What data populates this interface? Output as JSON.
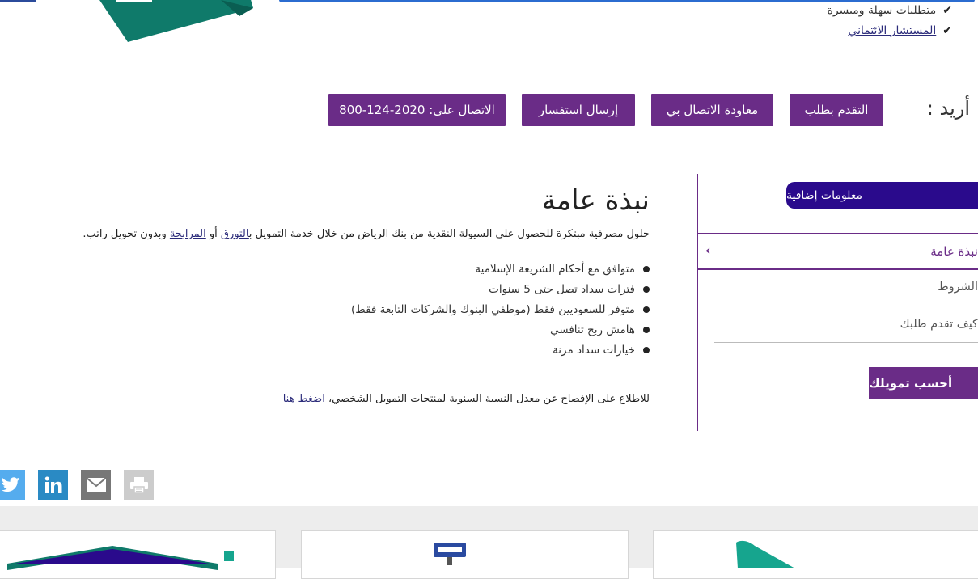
{
  "features": [
    {
      "label": "متطلبات سهلة وميسرة",
      "link": false
    },
    {
      "label": "المستشار الائتماني",
      "link": true
    }
  ],
  "actions": {
    "want_label": "أريد :",
    "apply": "التقدم بطلب",
    "callback": "معاودة الاتصال بي",
    "inquiry": "إرسال استفسار",
    "call": "الاتصال على: 2020-124-800"
  },
  "overview": {
    "title": "نبذة عامة",
    "intro_before": "حلول مصرفية مبتكرة للحصول على السيولة النقدية من بنك الرياض من خلال خدمة التمويل ب",
    "intro_link1": "التورق",
    "intro_mid": " أو ",
    "intro_link2": "المرابحة",
    "intro_after": " وبدون تحويل راتب.",
    "bullets": [
      "متوافق مع أحكام الشريعة الإسلامية",
      "فترات سداد تصل حتى 5 سنوات",
      "متوفر للسعوديين فقط (موظفي البنوك والشركات التابعة فقط)",
      "هامش ربح تنافسي",
      "خيارات سداد مرنة"
    ],
    "apr_text": "للاطلاع على الإفصاح عن معدل النسبة السنوية لمنتجات التمويل الشخصي، ",
    "apr_link": "اضغط هنا"
  },
  "sidebar": {
    "more_info": "معلومات إضافية",
    "active": "نبذة عامة",
    "items": [
      "الشروط",
      "كيف تقدم طلبك"
    ],
    "calc": "أحسب تمويلك"
  },
  "share_icons": [
    "twitter-icon",
    "linkedin-icon",
    "email-icon",
    "print-icon"
  ],
  "colors": {
    "primary": "#6a2c87",
    "tab": "#2a0a8c",
    "twitter": "#55acee",
    "linkedin": "#2a8ac4",
    "email": "#777777",
    "print": "#cccccc",
    "teal": "#0f7a6a"
  }
}
